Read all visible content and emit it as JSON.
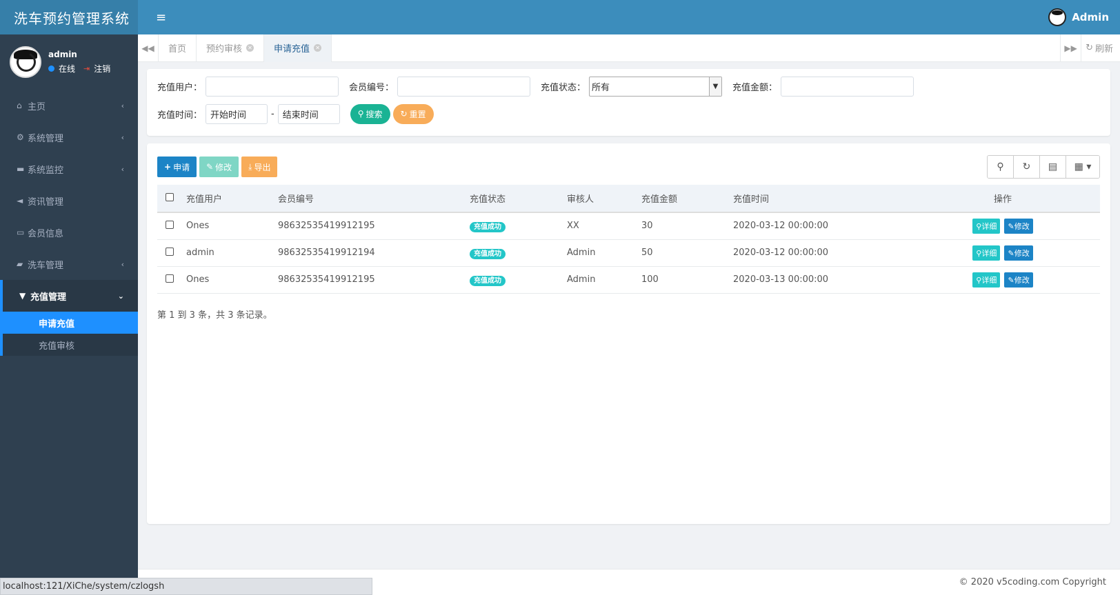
{
  "app": {
    "title": "洗车预约管理系统"
  },
  "user": {
    "name": "admin",
    "status": "在线",
    "logout": "注销"
  },
  "header": {
    "username": "Admin"
  },
  "sidebar": {
    "items": [
      {
        "label": "主页",
        "icon": "home-icon",
        "glyph": "⌂",
        "arrow": "‹"
      },
      {
        "label": "系统管理",
        "icon": "gear-icon",
        "glyph": "⚙",
        "arrow": "‹"
      },
      {
        "label": "系统监控",
        "icon": "video-icon",
        "glyph": "▬",
        "arrow": "‹"
      },
      {
        "label": "资讯管理",
        "icon": "bullhorn-icon",
        "glyph": "◄",
        "arrow": ""
      },
      {
        "label": "会员信息",
        "icon": "credit-card-icon",
        "glyph": "▭",
        "arrow": ""
      },
      {
        "label": "洗车管理",
        "icon": "car-icon",
        "glyph": "▰",
        "arrow": "‹"
      }
    ],
    "active_parent": {
      "label": "充值管理",
      "icon": "shopping-cart-icon",
      "glyph": "▼",
      "arrow": "⌄"
    },
    "sub_items": [
      {
        "label": "申请充值",
        "active": true
      },
      {
        "label": "充值审核",
        "active": false
      }
    ]
  },
  "tabs": {
    "items": [
      {
        "label": "首页",
        "closable": false,
        "active": false
      },
      {
        "label": "预约审核",
        "closable": true,
        "active": false
      },
      {
        "label": "申请充值",
        "closable": true,
        "active": true
      }
    ],
    "refresh_label": "刷新"
  },
  "search": {
    "user_label": "充值用户：",
    "member_no_label": "会员编号：",
    "status_label": "充值状态：",
    "status_value": "所有",
    "amount_label": "充值金额：",
    "time_label": "充值时间：",
    "start_placeholder": "开始时间",
    "separator": "-",
    "end_placeholder": "结束时间",
    "search_button": "搜索",
    "reset_button": "重置"
  },
  "toolbar": {
    "add_label": "申请",
    "edit_label": "修改",
    "export_label": "导出"
  },
  "table": {
    "columns": [
      "充值用户",
      "会员编号",
      "充值状态",
      "审核人",
      "充值金额",
      "充值时间",
      "操作"
    ],
    "rows": [
      {
        "user": "Ones",
        "member_no": "98632535419912195",
        "status": "充值成功",
        "reviewer": "XX",
        "amount": "30",
        "time": "2020-03-12 00:00:00"
      },
      {
        "user": "admin",
        "member_no": "98632535419912194",
        "status": "充值成功",
        "reviewer": "Admin",
        "amount": "50",
        "time": "2020-03-12 00:00:00"
      },
      {
        "user": "Ones",
        "member_no": "98632535419912195",
        "status": "充值成功",
        "reviewer": "Admin",
        "amount": "100",
        "time": "2020-03-13 00:00:00"
      }
    ],
    "detail_label": "详细",
    "edit_label": "修改",
    "summary": "第 1 到 3 条，共 3 条记录。"
  },
  "footer": {
    "copyright": "© 2020 v5coding.com Copyright"
  },
  "statusbar": {
    "url": "localhost:121/XiChe/system/czlogsh"
  },
  "colors": {
    "sidebar": "#2f4050",
    "header": "#3c8dbc",
    "accent": "#1e90ff",
    "success": "#1ab394",
    "warning": "#f8ac59",
    "info": "#23c6c8",
    "primary": "#1c84c6"
  }
}
